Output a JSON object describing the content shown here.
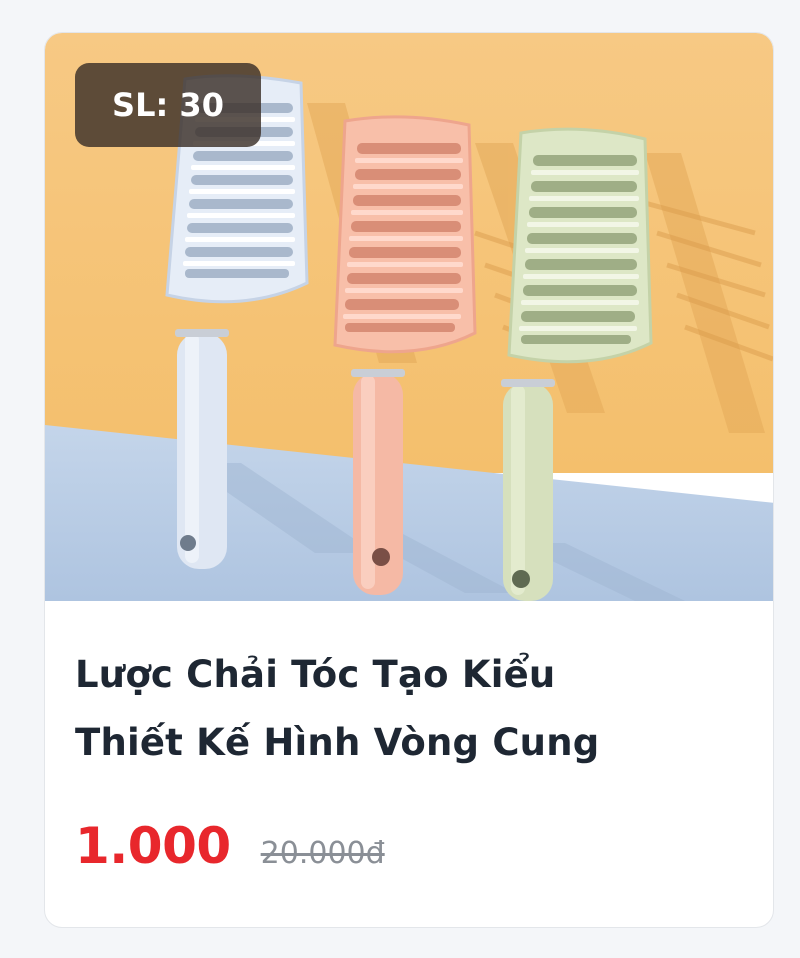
{
  "product": {
    "quantity_label": "SL: 30",
    "title_line1": "Lược Chải Tóc Tạo Kiểu",
    "title_line2": "Thiết Kế Hình Vòng Cung",
    "price": "1.000",
    "original_price": "20.000đ",
    "colors": {
      "price": "#e8272c",
      "title": "#1e2733",
      "original_price": "#8a8f96",
      "wall": "#f7c87a",
      "floor": "#b9cde6"
    },
    "image_items": [
      "blue-hairbrush",
      "pink-hairbrush",
      "green-hairbrush"
    ]
  }
}
